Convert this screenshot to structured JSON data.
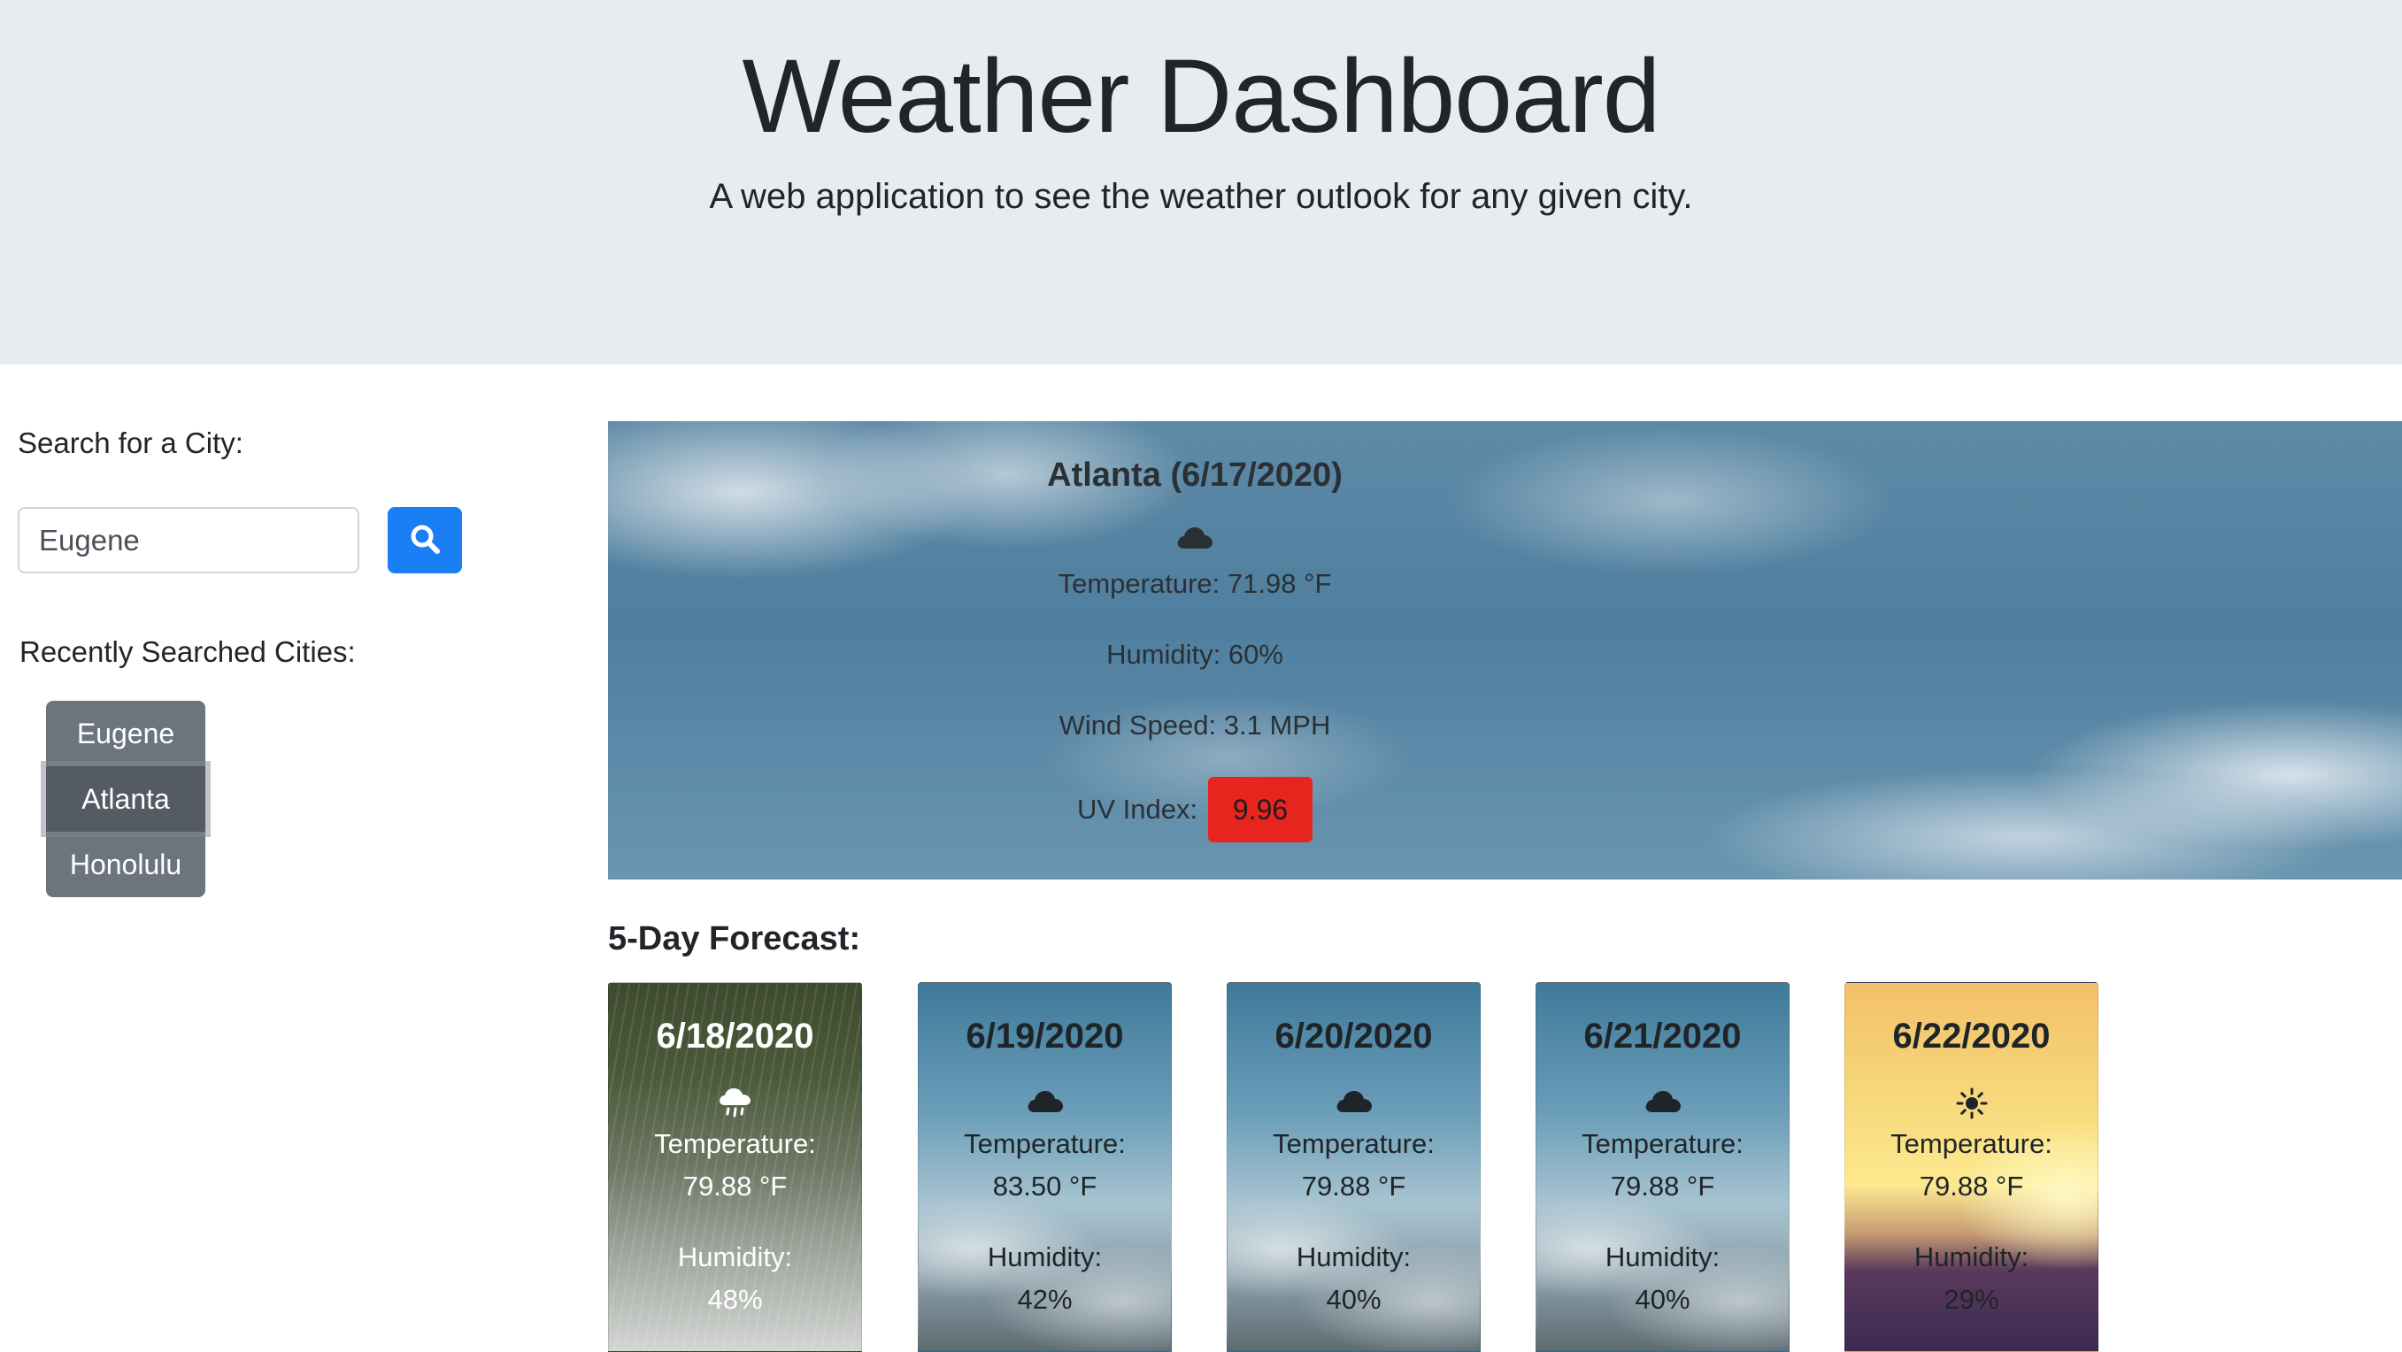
{
  "header": {
    "title": "Weather Dashboard",
    "subtitle": "A web application to see the weather outlook for any given city."
  },
  "sidebar": {
    "search_label": "Search for a City:",
    "search_value": "Eugene",
    "search_button_icon": "search-icon",
    "recent_label": "Recently Searched Cities:",
    "recent_cities": [
      {
        "label": "Eugene",
        "active": false
      },
      {
        "label": "Atlanta",
        "active": true
      },
      {
        "label": "Honolulu",
        "active": false
      }
    ]
  },
  "current": {
    "city_date": "Atlanta (6/17/2020)",
    "icon": "cloud-icon",
    "temperature": "Temperature: 71.98 °F",
    "humidity": "Humidity: 60%",
    "wind": "Wind Speed: 3.1 MPH",
    "uv_label": "UV Index:",
    "uv_value": "9.96",
    "uv_color": "#e8241f"
  },
  "forecast": {
    "title": "5-Day Forecast:",
    "days": [
      {
        "date": "6/18/2020",
        "icon": "rain-cloud-icon",
        "temp_label": "Temperature:",
        "temp": "79.88 °F",
        "hum_label": "Humidity:",
        "hum": "48%"
      },
      {
        "date": "6/19/2020",
        "icon": "cloud-icon",
        "temp_label": "Temperature:",
        "temp": "83.50 °F",
        "hum_label": "Humidity:",
        "hum": "42%"
      },
      {
        "date": "6/20/2020",
        "icon": "cloud-icon",
        "temp_label": "Temperature:",
        "temp": "79.88 °F",
        "hum_label": "Humidity:",
        "hum": "40%"
      },
      {
        "date": "6/21/2020",
        "icon": "cloud-icon",
        "temp_label": "Temperature:",
        "temp": "79.88 °F",
        "hum_label": "Humidity:",
        "hum": "40%"
      },
      {
        "date": "6/22/2020",
        "icon": "sun-icon",
        "temp_label": "Temperature:",
        "temp": "79.88 °F",
        "hum_label": "Humidity:",
        "hum": "29%"
      }
    ]
  },
  "colors": {
    "header_bg": "#e9ecef",
    "primary": "#1a7ef5",
    "secondary": "#6c757d"
  }
}
